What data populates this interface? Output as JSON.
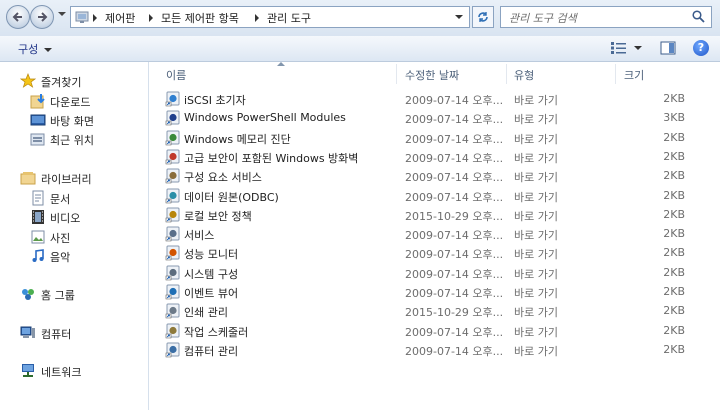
{
  "address": {
    "crumbs": [
      "제어판",
      "모든 제어판 항목",
      "관리 도구"
    ],
    "search_placeholder": "관리 도구 검색"
  },
  "toolbar": {
    "organize_label": "구성"
  },
  "nav": {
    "favorites": {
      "label": "즐겨찾기",
      "items": [
        "다운로드",
        "바탕 화면",
        "최근 위치"
      ]
    },
    "libraries": {
      "label": "라이브러리",
      "items": [
        "문서",
        "비디오",
        "사진",
        "음악"
      ]
    },
    "homegroup": "홈 그룹",
    "computer": "컴퓨터",
    "network": "네트워크"
  },
  "columns": {
    "name": "이름",
    "date": "수정한 날짜",
    "type": "유형",
    "size": "크기"
  },
  "files": [
    {
      "name": "iSCSI 초기자",
      "date": "2009-07-14 오후...",
      "type": "바로 가기",
      "size": "2KB",
      "icon": "iscsi-icon"
    },
    {
      "name": "Windows PowerShell Modules",
      "date": "2009-07-14 오후...",
      "type": "바로 가기",
      "size": "3KB",
      "icon": "powershell-icon"
    },
    {
      "name": "Windows 메모리 진단",
      "date": "2009-07-14 오후...",
      "type": "바로 가기",
      "size": "2KB",
      "icon": "memory-diagnostic-icon"
    },
    {
      "name": "고급 보안이 포함된 Windows 방화벽",
      "date": "2009-07-14 오후...",
      "type": "바로 가기",
      "size": "2KB",
      "icon": "firewall-icon"
    },
    {
      "name": "구성 요소 서비스",
      "date": "2009-07-14 오후...",
      "type": "바로 가기",
      "size": "2KB",
      "icon": "component-services-icon"
    },
    {
      "name": "데이터 원본(ODBC)",
      "date": "2009-07-14 오후...",
      "type": "바로 가기",
      "size": "2KB",
      "icon": "odbc-icon"
    },
    {
      "name": "로컬 보안 정책",
      "date": "2015-10-29 오후...",
      "type": "바로 가기",
      "size": "2KB",
      "icon": "security-policy-icon"
    },
    {
      "name": "서비스",
      "date": "2009-07-14 오후...",
      "type": "바로 가기",
      "size": "2KB",
      "icon": "services-icon"
    },
    {
      "name": "성능 모니터",
      "date": "2009-07-14 오후...",
      "type": "바로 가기",
      "size": "2KB",
      "icon": "performance-monitor-icon"
    },
    {
      "name": "시스템 구성",
      "date": "2009-07-14 오후...",
      "type": "바로 가기",
      "size": "2KB",
      "icon": "system-config-icon"
    },
    {
      "name": "이벤트 뷰어",
      "date": "2009-07-14 오후...",
      "type": "바로 가기",
      "size": "2KB",
      "icon": "event-viewer-icon"
    },
    {
      "name": "인쇄 관리",
      "date": "2015-10-29 오후...",
      "type": "바로 가기",
      "size": "2KB",
      "icon": "print-management-icon"
    },
    {
      "name": "작업 스케줄러",
      "date": "2009-07-14 오후...",
      "type": "바로 가기",
      "size": "2KB",
      "icon": "task-scheduler-icon"
    },
    {
      "name": "컴퓨터 관리",
      "date": "2009-07-14 오후...",
      "type": "바로 가기",
      "size": "2KB",
      "icon": "computer-management-icon"
    }
  ]
}
